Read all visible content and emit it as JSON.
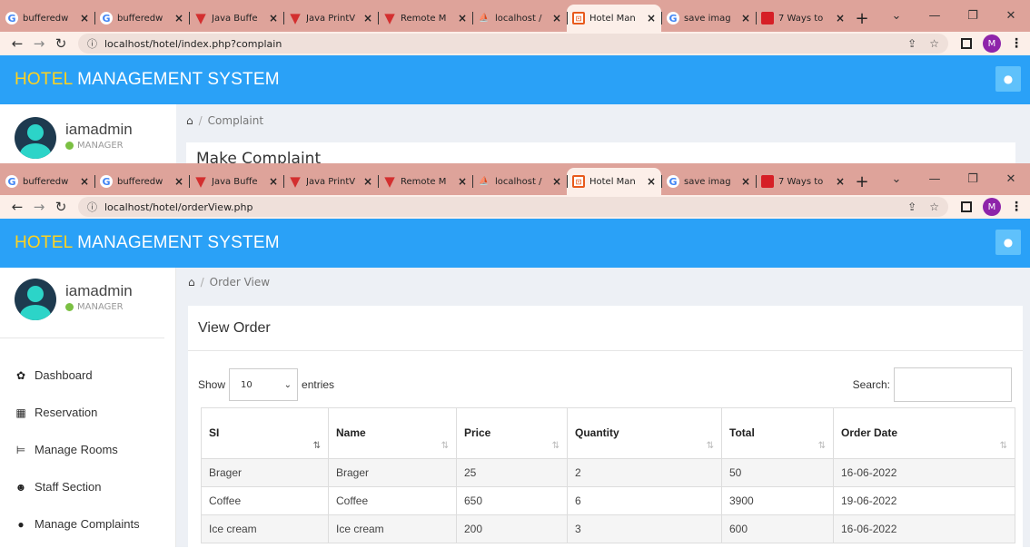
{
  "top_window": {
    "tabs": [
      {
        "favicon": "google-icon",
        "title": "bufferedw"
      },
      {
        "favicon": "google-icon",
        "title": "bufferedw"
      },
      {
        "favicon": "v-icon",
        "title": "Java Buffe"
      },
      {
        "favicon": "v-icon",
        "title": "Java PrintV"
      },
      {
        "favicon": "v-icon",
        "title": "Remote M"
      },
      {
        "favicon": "phpmyadmin-icon",
        "title": "localhost /"
      },
      {
        "favicon": "hotel-icon",
        "title": "Hotel Man",
        "active": true
      },
      {
        "favicon": "google-icon",
        "title": "save imag"
      },
      {
        "favicon": "red-square-icon",
        "title": "7 Ways to"
      }
    ],
    "url": "localhost/hotel/index.php?complain",
    "breadcrumb": "Complaint",
    "panel_title": "Make Complaint"
  },
  "bottom_window": {
    "tabs": [
      {
        "favicon": "google-icon",
        "title": "bufferedw"
      },
      {
        "favicon": "google-icon",
        "title": "bufferedw"
      },
      {
        "favicon": "v-icon",
        "title": "Java Buffe"
      },
      {
        "favicon": "v-icon",
        "title": "Java PrintV"
      },
      {
        "favicon": "v-icon",
        "title": "Remote M"
      },
      {
        "favicon": "phpmyadmin-icon",
        "title": "localhost /"
      },
      {
        "favicon": "hotel-icon",
        "title": "Hotel Man",
        "active": true
      },
      {
        "favicon": "google-icon",
        "title": "save imag"
      },
      {
        "favicon": "red-square-icon",
        "title": "7 Ways to"
      }
    ],
    "url": "localhost/hotel/orderView.php",
    "breadcrumb": "Order View",
    "panel_title": "View Order"
  },
  "app": {
    "brand_accent": "HOTEL",
    "brand_rest": " MANAGEMENT SYSTEM",
    "header_color": "#2aa1f7",
    "accent_color": "#ffd21f"
  },
  "profile": {
    "name": "iamadmin",
    "role": "MANAGER"
  },
  "browser": {
    "profile_initial": "M"
  },
  "sidebar": {
    "items": [
      {
        "icon": "dashboard-icon",
        "label": "Dashboard"
      },
      {
        "icon": "calendar-icon",
        "label": "Reservation"
      },
      {
        "icon": "bed-icon",
        "label": "Manage Rooms"
      },
      {
        "icon": "users-icon",
        "label": "Staff Section"
      },
      {
        "icon": "comments-icon",
        "label": "Manage Complaints"
      }
    ]
  },
  "table_controls": {
    "show_label": "Show",
    "entries_value": "10",
    "entries_label": "entries",
    "search_label": "Search:",
    "search_value": ""
  },
  "table": {
    "columns": [
      "SI",
      "Name",
      "Price",
      "Quantity",
      "Total",
      "Order Date"
    ],
    "rows": [
      [
        "Brager",
        "Brager",
        "25",
        "2",
        "50",
        "16-06-2022"
      ],
      [
        "Coffee",
        "Coffee",
        "650",
        "6",
        "3900",
        "19-06-2022"
      ],
      [
        "Ice cream",
        "Ice cream",
        "200",
        "3",
        "600",
        "16-06-2022"
      ]
    ]
  }
}
